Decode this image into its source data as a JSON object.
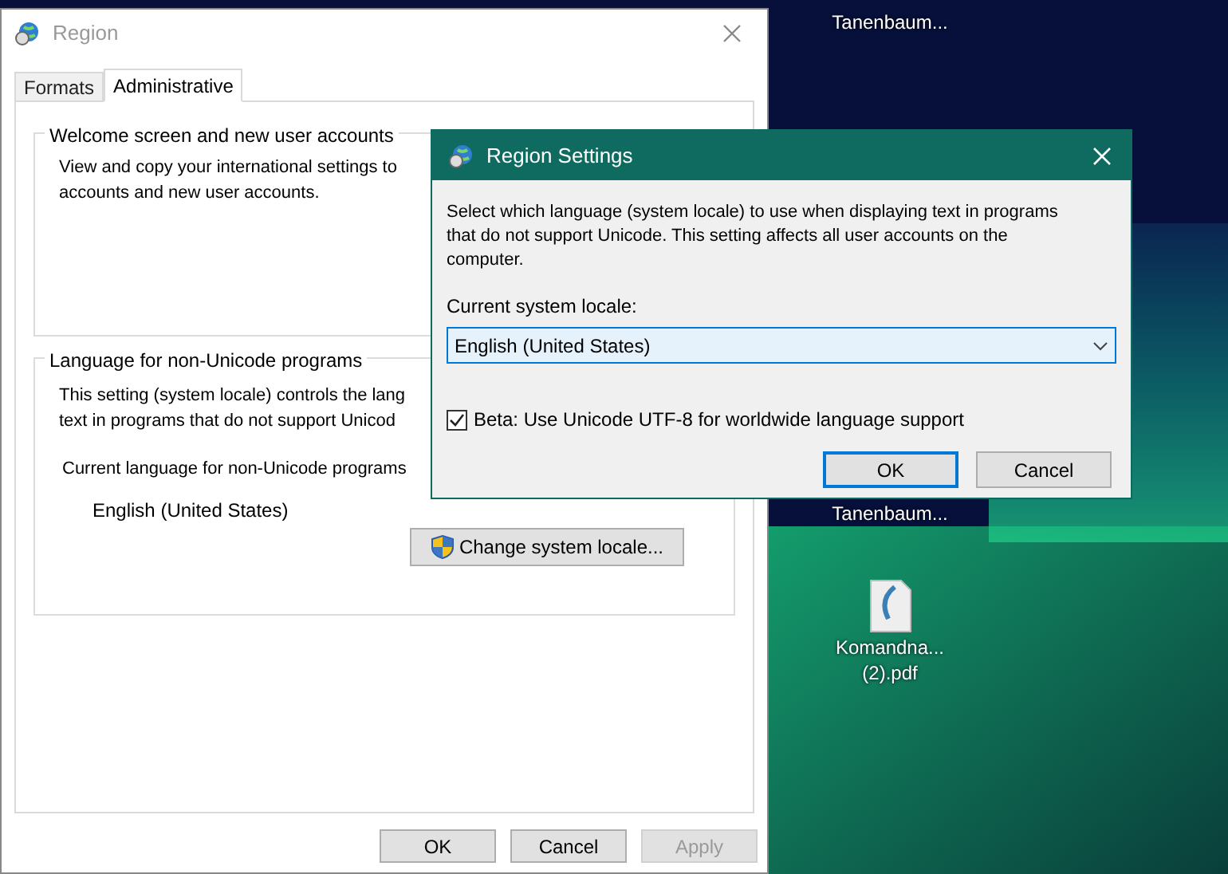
{
  "desktop": {
    "icons": [
      {
        "label": "Tanenbaum..."
      },
      {
        "label": "Tanenbaum..."
      },
      {
        "label": "Komandna... (2).pdf"
      }
    ]
  },
  "region_window": {
    "title": "Region",
    "tabs": [
      {
        "label": "Formats",
        "selected": false
      },
      {
        "label": "Administrative",
        "selected": true
      }
    ],
    "welcome_group": {
      "title": "Welcome screen and new user accounts",
      "text_lines": [
        "View and copy your international settings to",
        "accounts and new user accounts."
      ]
    },
    "language_group": {
      "title": "Language for non-Unicode programs",
      "text_lines": [
        "This setting (system locale) controls the lang",
        "text in programs that do not support Unicod"
      ],
      "current_label": "Current language for non-Unicode programs",
      "current_value": "English (United States)",
      "button": "Change system locale..."
    },
    "buttons": [
      {
        "label": "OK",
        "disabled": false
      },
      {
        "label": "Cancel",
        "disabled": false
      },
      {
        "label": "Apply",
        "disabled": true
      }
    ]
  },
  "settings_dialog": {
    "title": "Region Settings",
    "description": "Select which language (system locale) to use when displaying text in programs that do not support Unicode. This setting affects all user accounts on the computer.",
    "locale_label": "Current system locale:",
    "locale_value": "English (United States)",
    "beta_checkbox": {
      "label": "Beta: Use Unicode UTF-8 for worldwide language support",
      "checked": true
    },
    "buttons": [
      {
        "label": "OK",
        "default": true
      },
      {
        "label": "Cancel",
        "default": false
      }
    ]
  }
}
